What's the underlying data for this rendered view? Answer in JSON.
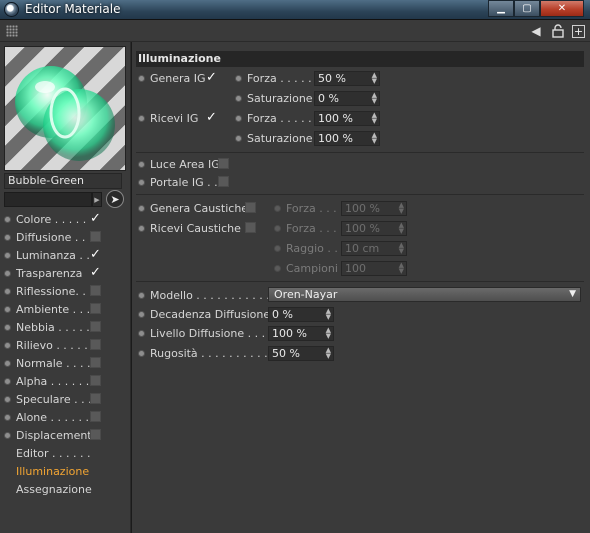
{
  "window": {
    "title": "Editor Materiale",
    "minimize": "▁",
    "maximize": "▢",
    "close": "✕"
  },
  "toolbar": {
    "arrow_glyph": "◀",
    "lock_glyph": "🔓",
    "plus_glyph": "+"
  },
  "material": {
    "name": "Bubble-Green",
    "field_value": ""
  },
  "channels": [
    {
      "label": "Colore . . . . .",
      "checked": true
    },
    {
      "label": "Diffusione . . .",
      "checked": false
    },
    {
      "label": "Luminanza . .",
      "checked": true
    },
    {
      "label": "Trasparenza",
      "checked": true
    },
    {
      "label": "Riflessione. . .",
      "checked": false
    },
    {
      "label": "Ambiente . . . .",
      "checked": false
    },
    {
      "label": "Nebbia . . . . . .",
      "checked": false
    },
    {
      "label": "Rilievo . . . . . .",
      "checked": false
    },
    {
      "label": "Normale . . . . .",
      "checked": false
    },
    {
      "label": "Alpha . . . . . .",
      "checked": false
    },
    {
      "label": "Speculare . . . .",
      "checked": false
    },
    {
      "label": "Alone . . . . . . .",
      "checked": false
    },
    {
      "label": "Displacement",
      "checked": false
    }
  ],
  "extras": [
    {
      "label": "Editor . . . . . .",
      "active": false
    },
    {
      "label": "Illuminazione",
      "active": true
    },
    {
      "label": "Assegnazione",
      "active": false
    }
  ],
  "check_glyph": "✓",
  "section_title": "Illuminazione",
  "gi": {
    "genera_label": "Genera IG",
    "ricevi_label": "Ricevi IG",
    "forza_label": "Forza . . . . .",
    "saturazione_label": "Saturazione",
    "genera_forza": "50 %",
    "genera_saturazione": "0 %",
    "ricevi_forza": "100 %",
    "ricevi_saturazione": "100 %"
  },
  "area": {
    "luce_label": "Luce Area IG",
    "portale_label": "Portale IG . ."
  },
  "caustics": {
    "genera_label": "Genera Caustiche",
    "ricevi_label": "Ricevi Caustiche",
    "forza_label": "Forza . . . .",
    "raggio_label": "Raggio . . .",
    "campioni_label": "Campioni",
    "genera_forza": "100 %",
    "ricevi_forza": "100 %",
    "raggio": "10 cm",
    "campioni": "100"
  },
  "model": {
    "modello_label": "Modello . . . . . . . . . . . .",
    "modello_value": "Oren-Nayar",
    "decadenza_label": "Decadenza Diffusione",
    "decadenza_value": "0 %",
    "livello_label": "Livello Diffusione . . . .",
    "livello_value": "100 %",
    "rugosita_label": "Rugosità . . . . . . . . . . .",
    "rugosita_value": "50 %"
  },
  "spin_glyph": "▲▼",
  "caret_glyph": "▼",
  "colors": {
    "accent": "#f2a533",
    "panel": "#3a3a3a",
    "titlebar": "#2c4458"
  }
}
